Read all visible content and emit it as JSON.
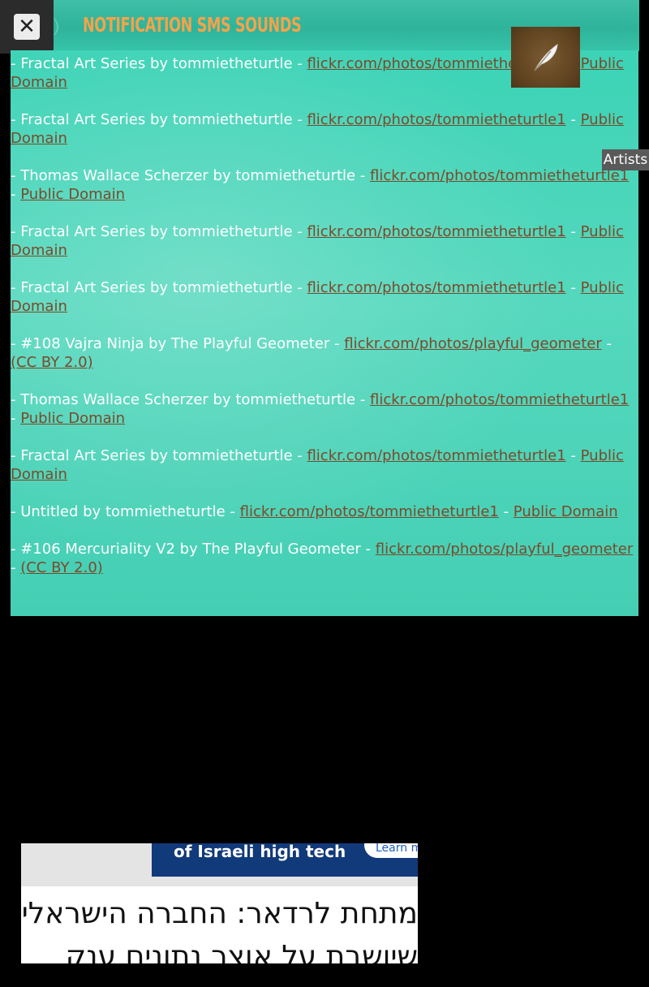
{
  "header": {
    "title": "NOTIFICATION SMS SOUNDS",
    "close_symbol": "✕"
  },
  "artists_tab": "Artists",
  "credits": [
    {
      "prefix": "- Fractal Art Series by tommietheturtle - ",
      "link": "flickr.com/photos/tommietheturtle1",
      "sep": " - ",
      "license": "Public Domain"
    },
    {
      "prefix": "- Fractal Art Series by tommietheturtle - ",
      "link": "flickr.com/photos/tommietheturtle1",
      "sep": " - ",
      "license": "Public Domain"
    },
    {
      "prefix": "- Thomas Wallace Scherzer by tommietheturtle - ",
      "link": "flickr.com/photos/tommietheturtle1 ",
      "sep": " - ",
      "license": "Public Domain"
    },
    {
      "prefix": "- Fractal Art Series by tommietheturtle - ",
      "link": "flickr.com/photos/tommietheturtle1",
      "sep": " - ",
      "license": "Public Domain"
    },
    {
      "prefix": "- Fractal Art Series by tommietheturtle - ",
      "link": "flickr.com/photos/tommietheturtle1",
      "sep": " - ",
      "license": "Public Domain"
    },
    {
      "prefix": "- #108 Vajra Ninja by The Playful Geometer - ",
      "link": "flickr.com/photos/playful_geometer",
      "sep": " - ",
      "license": "(CC BY 2.0)"
    },
    {
      "prefix": "- Thomas Wallace Scherzer by tommietheturtle - ",
      "link": "flickr.com/photos/tommietheturtle1 ",
      "sep": " - ",
      "license": "Public Domain"
    },
    {
      "prefix": "- Fractal Art Series by tommietheturtle - ",
      "link": "flickr.com/photos/tommietheturtle1",
      "sep": " - ",
      "license": "Public Domain"
    },
    {
      "prefix": "- Untitled by tommietheturtle - ",
      "link": "flickr.com/photos/tommietheturtle1",
      "sep": " - ",
      "license": "Public Domain"
    },
    {
      "prefix": "- #106 Mercuriality V2 by The Playful Geometer - ",
      "link": "flickr.com/photos/playful_geometer",
      "sep": " - ",
      "license": "(CC BY 2.0)"
    }
  ],
  "ad": {
    "banner_text": "of Israeli high tech",
    "banner_button": "Learn m",
    "headline": "מתחת לרדאר: החברה הישראלית",
    "subline": "שיושבת על אוצר נתונים ענק"
  },
  "colors": {
    "accent_title": "#f4a34a",
    "link": "#7a4a2b",
    "content_bg": "#44cfb4"
  }
}
